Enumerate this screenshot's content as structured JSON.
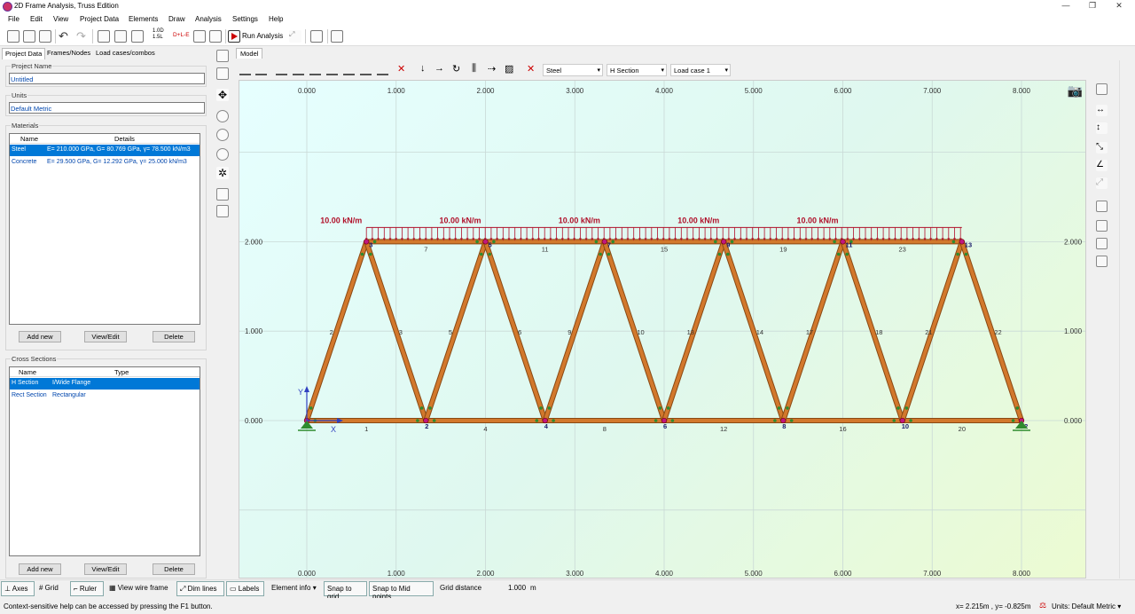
{
  "window": {
    "title": "2D Frame Analysis, Truss Edition"
  },
  "menu": [
    "File",
    "Edit",
    "View",
    "Project Data",
    "Elements",
    "Draw",
    "Analysis",
    "Settings",
    "Help"
  ],
  "toolbar": {
    "run_label": "Run Analysis",
    "factor1": "1.0D",
    "factor2": "1.5L",
    "combo_label": "D+L-E"
  },
  "left_tabs": [
    "Project Data",
    "Frames/Nodes",
    "Load cases/combos"
  ],
  "project": {
    "name_label": "Project Name",
    "name_value": "Untitled",
    "units_label": "Units",
    "units_value": "Default Metric"
  },
  "materials": {
    "label": "Materials",
    "col_name": "Name",
    "col_details": "Details",
    "rows": [
      {
        "name": "Steel",
        "details": "E= 210.000 GPa, G= 80.769 GPa, γ= 78.500 kN/m3"
      },
      {
        "name": "Concrete",
        "details": "E= 29.500 GPa, G= 12.292 GPa, γ= 25.000 kN/m3"
      }
    ],
    "add": "Add new",
    "edit": "View/Edit",
    "del": "Delete"
  },
  "sections": {
    "label": "Cross Sections",
    "col_name": "Name",
    "col_type": "Type",
    "rows": [
      {
        "name": "H Section",
        "type": "I/Wide Flange"
      },
      {
        "name": "Rect Section",
        "type": "Rectangular"
      }
    ],
    "add": "Add new",
    "edit": "View/Edit",
    "del": "Delete"
  },
  "model_tab": "Model",
  "model_toolbar": {
    "material": "Steel",
    "section": "H Section",
    "loadcase": "Load case 1"
  },
  "model": {
    "x_ticks": [
      "0.000",
      "1.000",
      "2.000",
      "3.000",
      "4.000",
      "5.000",
      "6.000",
      "7.000",
      "8.000"
    ],
    "y_ticks": [
      "0.000",
      "1.000",
      "2.000"
    ],
    "load_label": "10.00 kN/m",
    "axis_x_label": "X",
    "axis_y_label": "Y",
    "bottom_nodes": [
      {
        "id": "2",
        "x": 1.333
      },
      {
        "id": "4",
        "x": 2.667
      },
      {
        "id": "6",
        "x": 4.0
      },
      {
        "id": "8",
        "x": 5.333
      },
      {
        "id": "10",
        "x": 6.667
      },
      {
        "id": "12",
        "x": 8.0
      }
    ],
    "top_nodes": [
      {
        "id": "3",
        "x": 0.667
      },
      {
        "id": "5",
        "x": 2.0
      },
      {
        "id": "7",
        "x": 3.333
      },
      {
        "id": "9",
        "x": 4.667
      },
      {
        "id": "11",
        "x": 6.0
      },
      {
        "id": "13",
        "x": 7.333
      }
    ],
    "bottom_members": [
      "1",
      "4",
      "8",
      "12",
      "16",
      "20"
    ],
    "top_members": [
      "7",
      "11",
      "15",
      "19",
      "23"
    ],
    "diagonal_members": [
      "2",
      "3",
      "5",
      "6",
      "9",
      "10",
      "13",
      "14",
      "17",
      "18",
      "21",
      "22"
    ]
  },
  "bottom_toolbar": {
    "axes": "Axes",
    "grid": "Grid",
    "ruler": "Ruler",
    "wireframe": "View wire frame",
    "dimlines": "Dim lines",
    "labels": "Labels",
    "element_info": "Element info",
    "snap_grid": "Snap to grid",
    "snap_mid": "Snap to Mid points",
    "grid_distance_label": "Grid distance",
    "grid_distance_value": "1.000",
    "grid_distance_unit": "m"
  },
  "status": {
    "help": "Context-sensitive help can be accessed by pressing the F1 button.",
    "coords": "x= 2.215m , y= -0.825m",
    "units": "Units: Default Metric"
  },
  "colors": {
    "member": "#d2782c",
    "load": "#b0102a",
    "node": "#c0187f",
    "selection": "#0078d7"
  }
}
